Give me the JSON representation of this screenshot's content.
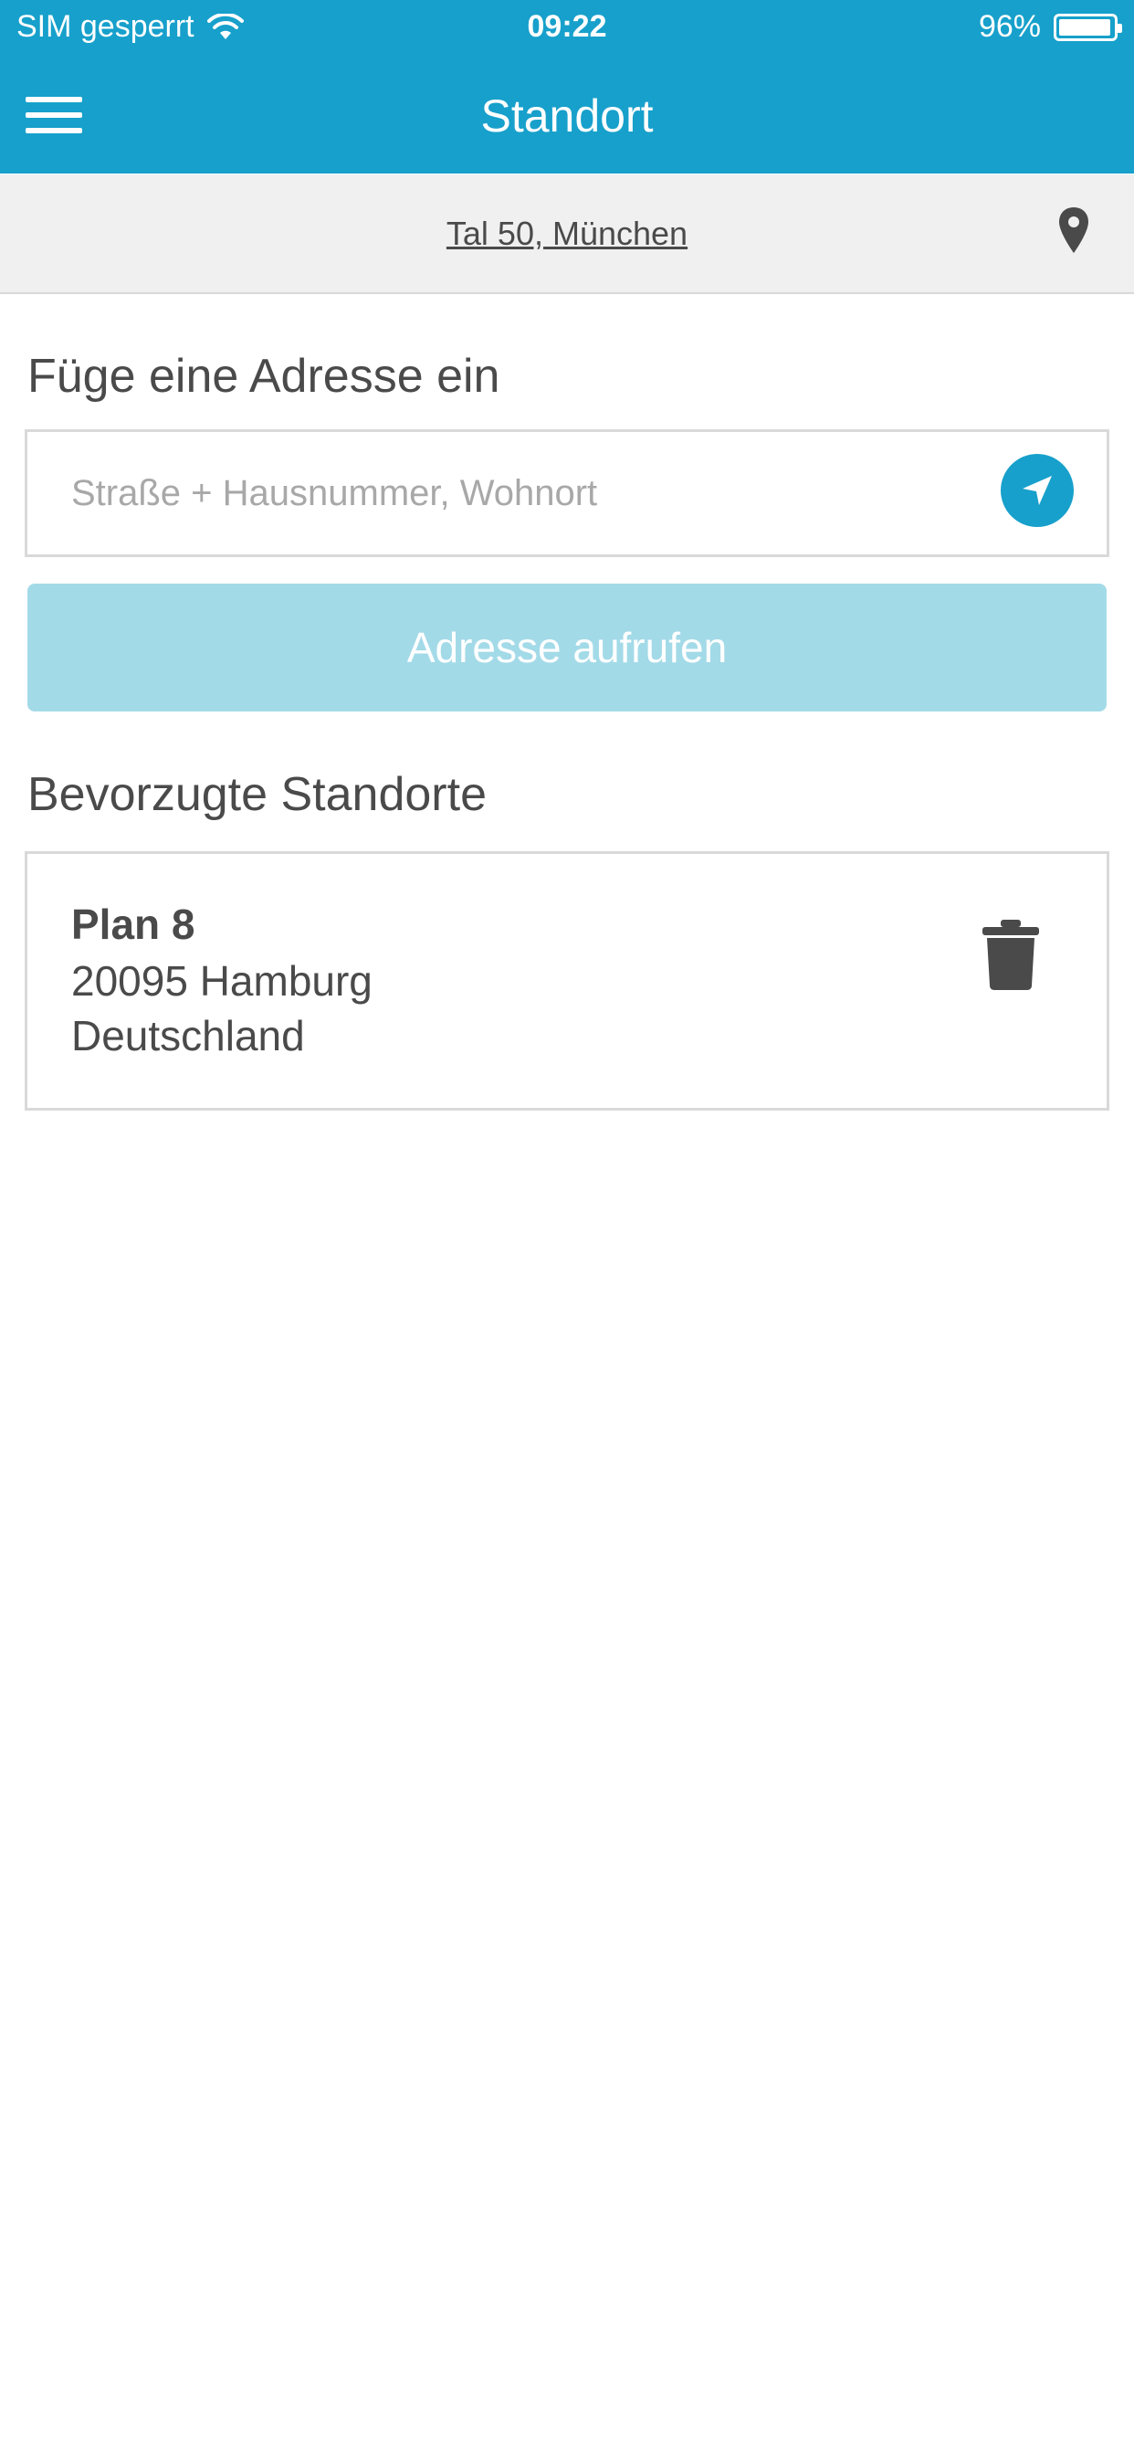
{
  "status_bar": {
    "carrier": "SIM gesperrt",
    "time": "09:22",
    "battery": "96%",
    "battery_level": 0.96
  },
  "nav": {
    "title": "Standort",
    "menu_icon": "hamburger-menu-icon"
  },
  "current_location": {
    "address": "Tal 50, München",
    "icon": "map-pin-icon"
  },
  "address_form": {
    "heading": "Füge eine Adresse ein",
    "placeholder": "Straße + Hausnummer, Wohnort",
    "value": "",
    "locate_icon": "location-arrow-icon",
    "submit_label": "Adresse aufrufen"
  },
  "favorites": {
    "heading": "Bevorzugte Standorte",
    "items": [
      {
        "street": "Plan 8",
        "city": "20095 Hamburg",
        "country": "Deutschland",
        "delete_icon": "trash-icon"
      }
    ]
  },
  "colors": {
    "primary": "#17a0cb",
    "button_disabled": "#a3dae8",
    "text": "#4a4a4a",
    "placeholder": "#a8a8a8",
    "location_bar_bg": "#f0f0f0",
    "border": "#d9d9d9"
  }
}
